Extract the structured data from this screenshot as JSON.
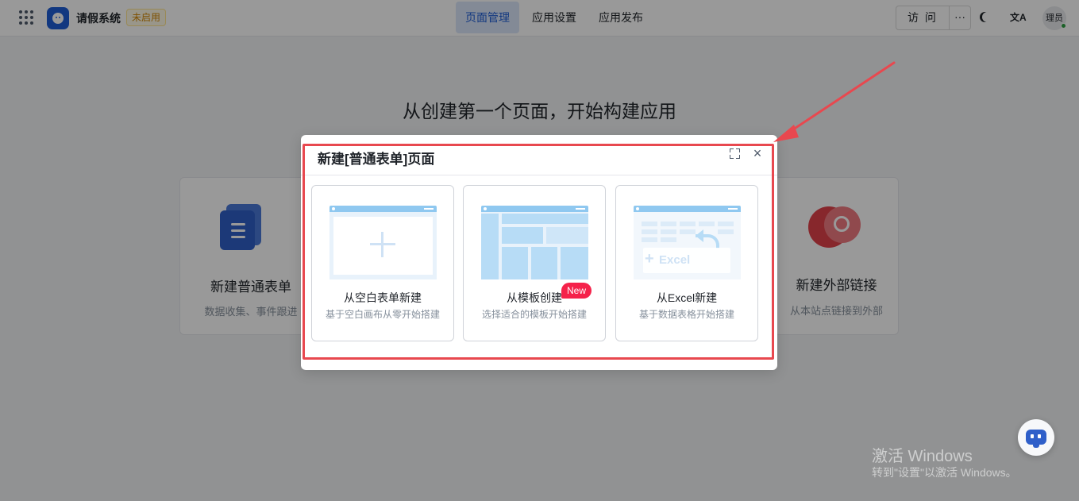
{
  "app": {
    "name": "请假系统",
    "status": "未启用"
  },
  "nav": {
    "tabs": [
      {
        "label": "页面管理",
        "active": true
      },
      {
        "label": "应用设置",
        "active": false
      },
      {
        "label": "应用发布",
        "active": false
      }
    ]
  },
  "header_actions": {
    "visit_label": "访 问",
    "more_label": "···",
    "translate_glyph": "文A",
    "avatar_text": "理员"
  },
  "main": {
    "heading": "从创建第一个页面，开始构建应用",
    "cards": [
      {
        "title": "新建普通表单",
        "desc": "数据收集、事件跟进"
      },
      {
        "title": "新建外部链接",
        "desc": "从本站点链接到外部"
      }
    ]
  },
  "modal": {
    "title": "新建[普通表单]页面",
    "close_glyph": "×",
    "options": [
      {
        "title": "从空白表单新建",
        "desc": "基于空白画布从零开始搭建"
      },
      {
        "title": "从模板创建",
        "desc": "选择适合的模板开始搭建",
        "badge": "New"
      },
      {
        "title": "从Excel新建",
        "desc": "基于数据表格开始搭建",
        "illustration_text": "Excel"
      }
    ]
  },
  "watermark": {
    "line1": "激活 Windows",
    "line2": "转到\"设置\"以激活 Windows。"
  },
  "colors": {
    "primary": "#1f5ed6",
    "badge_red": "#f5224a",
    "highlight_red": "#e8484f",
    "status_orange": "#d48806"
  }
}
